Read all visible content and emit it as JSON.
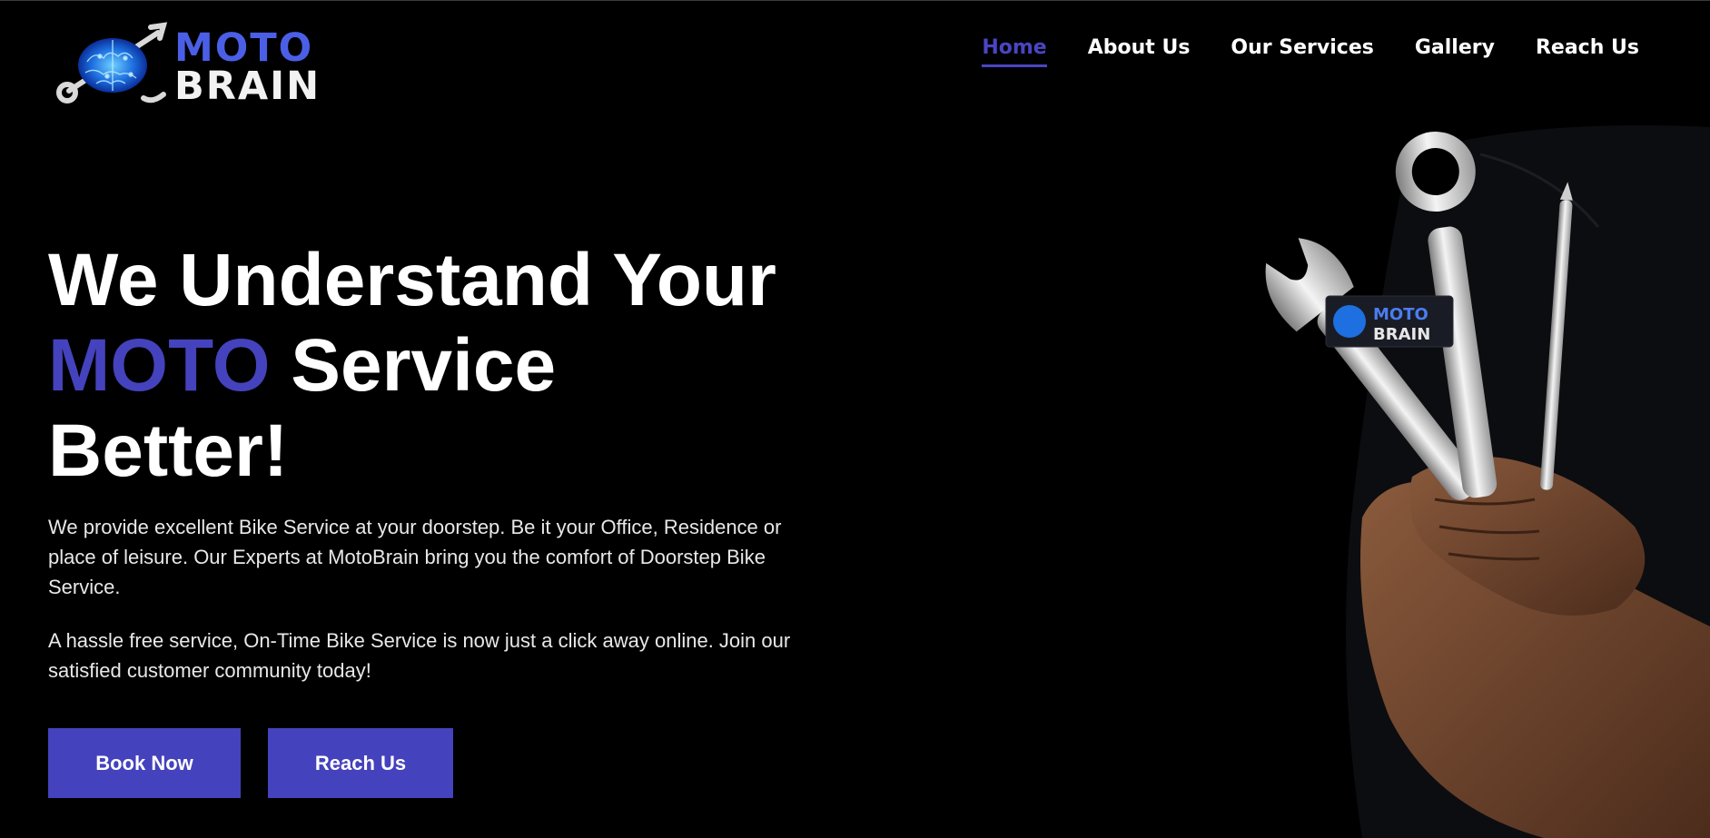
{
  "brand": {
    "line1": "MOTO",
    "line2": "BRAIN",
    "accent_color": "#4a45c4",
    "logo_icon": "brain-wrench-icon"
  },
  "nav": {
    "items": [
      {
        "label": "Home",
        "active": true
      },
      {
        "label": "About Us",
        "active": false
      },
      {
        "label": "Our Services",
        "active": false
      },
      {
        "label": "Gallery",
        "active": false
      },
      {
        "label": "Reach Us",
        "active": false
      }
    ]
  },
  "hero": {
    "title_line1": "We Understand Your",
    "title_accent": "MOTO",
    "title_line2_rest": " Service",
    "title_line3": "Better!",
    "paragraph1": "We provide excellent Bike Service at your doorstep. Be it your Office, Residence or place of leisure. Our Experts at MotoBrain bring you the comfort of Doorstep Bike Service.",
    "paragraph2": "A hassle free service, On-Time Bike Service is now just a click away online. Join our satisfied customer community today!",
    "book_button": "Book Now",
    "reach_button": "Reach Us"
  },
  "image": {
    "badge_line1": "MOTO",
    "badge_line2": "BRAIN"
  }
}
